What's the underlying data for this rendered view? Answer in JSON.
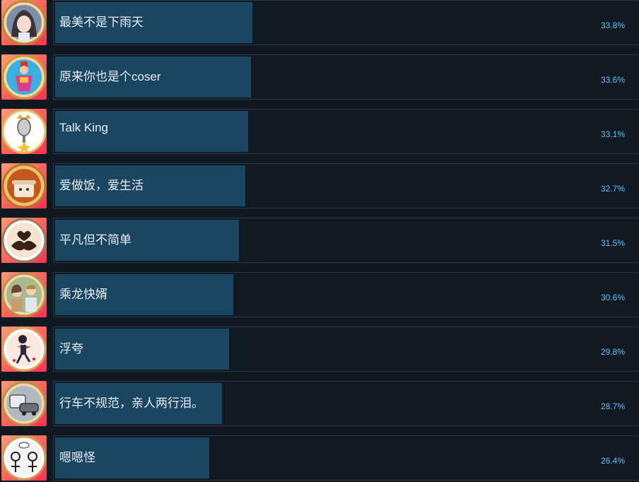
{
  "achievements": [
    {
      "label": "最美不是下雨天",
      "percent_text": "33.8%",
      "percent": 33.8,
      "icon": "anime-girl-portrait-icon"
    },
    {
      "label": "原来你也是个coser",
      "percent_text": "33.6%",
      "percent": 33.6,
      "icon": "costume-figure-icon"
    },
    {
      "label": "Talk King",
      "percent_text": "33.1%",
      "percent": 33.1,
      "icon": "crowned-microphone-icon"
    },
    {
      "label": "爱做饭，爱生活",
      "percent_text": "32.7%",
      "percent": 32.7,
      "icon": "cooking-pot-icon"
    },
    {
      "label": "平凡但不简单",
      "percent_text": "31.5%",
      "percent": 31.5,
      "icon": "heart-hands-icon"
    },
    {
      "label": "乘龙快婿",
      "percent_text": "30.6%",
      "percent": 30.6,
      "icon": "couple-portrait-icon"
    },
    {
      "label": "浮夸",
      "percent_text": "29.8%",
      "percent": 29.8,
      "icon": "dancing-man-icon"
    },
    {
      "label": "行车不规范，亲人两行泪。",
      "percent_text": "28.7%",
      "percent": 28.7,
      "icon": "car-crash-icon"
    },
    {
      "label": "嗯嗯怪",
      "percent_text": "26.4%",
      "percent": 26.4,
      "icon": "chatting-people-icon"
    }
  ],
  "colors": {
    "background": "#101822",
    "bar_fill": "#1a4661",
    "panel_border": "#24394a",
    "percent_text": "#66c0f4",
    "label_text": "#e6edf3",
    "icon_gradient_start": "#ff9a7a",
    "icon_gradient_end": "#ff2f55"
  }
}
